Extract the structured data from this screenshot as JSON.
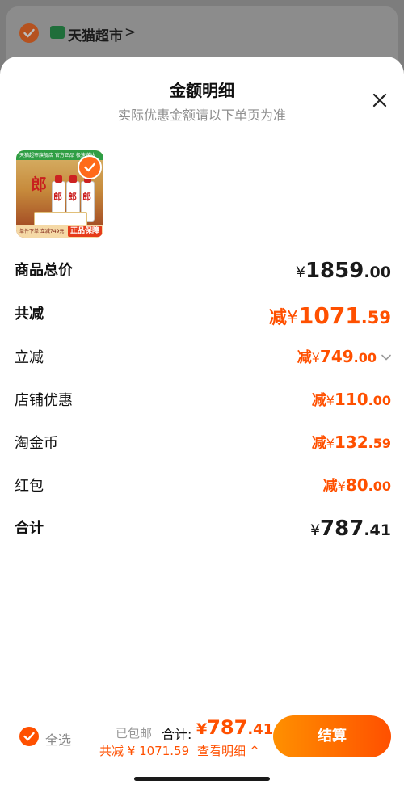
{
  "background": {
    "store_name": "天猫超市",
    "store_chevron": ">"
  },
  "sheet": {
    "title": "金额明细",
    "subtitle": "实际优惠金额请以下单页为准",
    "close_icon": "close-icon"
  },
  "product": {
    "banner_text": "天猫超市旗舰店 官方正品 极速送达",
    "brand_char": "郎",
    "bottle_chars": [
      "郎",
      "郎",
      "郎"
    ],
    "promo_text": "单件下单 立减749元",
    "guarantee": "正品保障"
  },
  "rows": {
    "total_price": {
      "label": "商品总价",
      "yen": "¥",
      "int": "1859",
      "dec": ".00"
    },
    "total_discount": {
      "label": "共减",
      "minus": "减",
      "yen": "¥",
      "int": "1071",
      "dec": ".59"
    },
    "instant_discount": {
      "label": "立减",
      "minus": "减",
      "yen": "¥",
      "int": "749",
      "dec": ".00"
    },
    "store_discount": {
      "label": "店铺优惠",
      "minus": "减",
      "yen": "¥",
      "int": "110",
      "dec": ".00"
    },
    "taojin_coin": {
      "label": "淘金币",
      "minus": "减",
      "yen": "¥",
      "int": "132",
      "dec": ".59"
    },
    "red_packet": {
      "label": "红包",
      "minus": "减",
      "yen": "¥",
      "int": "80",
      "dec": ".00"
    },
    "grand_total": {
      "label": "合计",
      "yen": "¥",
      "int": "787",
      "dec": ".41"
    }
  },
  "bottom": {
    "select_all": "全选",
    "shipping": "已包邮",
    "total_label": "合计:",
    "total_yen": "¥",
    "total_int": "787",
    "total_dec": ".41",
    "saved_text": "共减 ¥ 1071.59",
    "detail_link": "查看明细 ^",
    "checkout": "结算"
  },
  "colors": {
    "accent": "#ff5000",
    "accent_start": "#ff9000",
    "text": "#111111",
    "muted": "#8e8e8e"
  }
}
